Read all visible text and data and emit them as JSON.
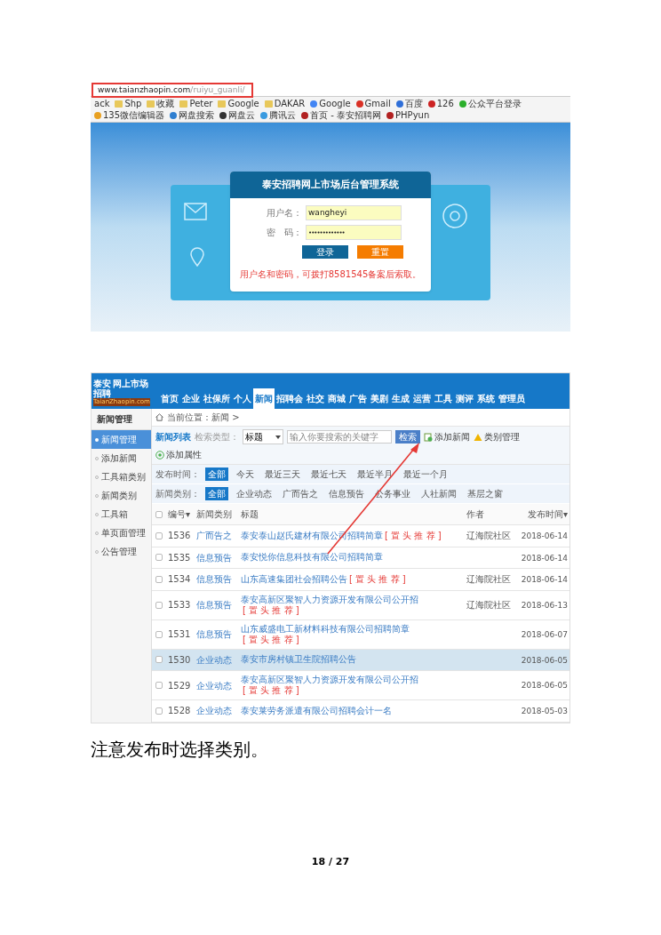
{
  "browser": {
    "url_host": "www.taianzhaopin.com",
    "url_path": "/ruiyu_guanli/",
    "url_highlighted": true,
    "bookmarks": [
      {
        "label": "ack",
        "kind": "text"
      },
      {
        "label": "Shp",
        "kind": "folder"
      },
      {
        "label": "收藏",
        "kind": "folder"
      },
      {
        "label": "Peter",
        "kind": "folder"
      },
      {
        "label": "Google",
        "kind": "folder"
      },
      {
        "label": "DAKAR",
        "kind": "folder"
      },
      {
        "label": "Google",
        "kind": "site",
        "color": "#4285f4"
      },
      {
        "label": "Gmail",
        "kind": "site",
        "color": "#d93025"
      },
      {
        "label": "百度",
        "kind": "site",
        "color": "#2f6fd8"
      },
      {
        "label": "126",
        "kind": "site",
        "color": "#cc2222"
      },
      {
        "label": "公众平台登录",
        "kind": "site",
        "color": "#2aae2a"
      },
      {
        "label": "135微信编辑器",
        "kind": "site",
        "color": "#e8a020"
      },
      {
        "label": "网盘搜索",
        "kind": "site",
        "color": "#2f7fd0"
      },
      {
        "label": "网盘云",
        "kind": "site",
        "color": "#333333"
      },
      {
        "label": "腾讯云",
        "kind": "site",
        "color": "#3a9be0"
      },
      {
        "label": "首页 - 泰安招聘网",
        "kind": "site",
        "color": "#b22222"
      },
      {
        "label": "PHPyun",
        "kind": "site",
        "color": "#b22222"
      }
    ]
  },
  "login": {
    "title": "泰安招聘网上市场后台管理系统",
    "fields": [
      {
        "label": "用户名：",
        "value": "wangheyi",
        "kind": "text"
      },
      {
        "label": "密　码：",
        "value": "•••••••••••••",
        "kind": "password"
      }
    ],
    "buttons": [
      {
        "label": "登录",
        "kind": "primary"
      },
      {
        "label": "重置",
        "kind": "reset"
      }
    ],
    "notice": "用户名和密码，可拨打8581545备案后索取。"
  },
  "admin": {
    "logo": {
      "line_1": "泰安",
      "line_2": "网上市场",
      "line_3": "招聘",
      "line_4": "TaianZhaopin.com"
    },
    "nav_tabs": [
      {
        "label": "首页",
        "selected": false
      },
      {
        "label": "企业",
        "selected": false
      },
      {
        "label": "社保所",
        "selected": false
      },
      {
        "label": "个人",
        "selected": false
      },
      {
        "label": "新闻",
        "selected": true
      },
      {
        "label": "招聘会",
        "selected": false
      },
      {
        "label": "社交",
        "selected": false
      },
      {
        "label": "商城",
        "selected": false
      },
      {
        "label": "广告",
        "selected": false
      },
      {
        "label": "美剧",
        "selected": false
      },
      {
        "label": "生成",
        "selected": false
      },
      {
        "label": "运营",
        "selected": false
      },
      {
        "label": "工具",
        "selected": false
      },
      {
        "label": "测评",
        "selected": false
      },
      {
        "label": "系统",
        "selected": false
      },
      {
        "label": "管理员",
        "selected": false
      }
    ],
    "sidebar": {
      "title": "新闻管理",
      "items": [
        {
          "label": "新闻管理",
          "selected": true
        },
        {
          "label": "添加新闻",
          "selected": false
        },
        {
          "label": "工具箱类别",
          "selected": false
        },
        {
          "label": "新闻类别",
          "selected": false
        },
        {
          "label": "工具箱",
          "selected": false
        },
        {
          "label": "单页面管理",
          "selected": false
        },
        {
          "label": "公告管理",
          "selected": false
        }
      ]
    },
    "breadcrumb": "当前位置：新闻 >",
    "toolbar": {
      "title": "新闻列表",
      "search_type_label": "检索类型：",
      "search_type_value": "标题",
      "search_placeholder": "输入你要搜索的关键字",
      "search_button": "检索",
      "actions": [
        {
          "label": "添加新闻",
          "kind": "add"
        },
        {
          "label": "类别管理",
          "kind": "category"
        },
        {
          "label": "添加属性",
          "kind": "attribute"
        }
      ]
    },
    "filters": [
      {
        "label": "发布时间：",
        "options": [
          {
            "label": "全部",
            "selected": true
          },
          {
            "label": "今天",
            "selected": false
          },
          {
            "label": "最近三天",
            "selected": false
          },
          {
            "label": "最近七天",
            "selected": false
          },
          {
            "label": "最近半月",
            "selected": false
          },
          {
            "label": "最近一个月",
            "selected": false
          }
        ]
      },
      {
        "label": "新闻类别：",
        "options": [
          {
            "label": "全部",
            "selected": true
          },
          {
            "label": "企业动态",
            "selected": false
          },
          {
            "label": "广而告之",
            "selected": false
          },
          {
            "label": "信息预告",
            "selected": false
          },
          {
            "label": "公务事业",
            "selected": false
          },
          {
            "label": "人社新闻",
            "selected": false
          },
          {
            "label": "基层之窗",
            "selected": false
          }
        ]
      }
    ],
    "table": {
      "select_all_checked": false,
      "columns": [
        "编号▾",
        "新闻类别",
        "标题",
        "作者",
        "发布时间▾"
      ],
      "rows": [
        {
          "id": "1536",
          "category": "广而告之",
          "title": "泰安泰山赵氏建材有限公司招聘简章",
          "tag": "[ 置 头 推 荐 ]",
          "author": "辽海院社区",
          "date": "2018-06-14",
          "selected": false
        },
        {
          "id": "1535",
          "category": "信息预告",
          "title": "泰安悦你信息科技有限公司招聘简章",
          "author": "",
          "date": "2018-06-14",
          "selected": false
        },
        {
          "id": "1534",
          "category": "信息预告",
          "title": "山东高速集团社会招聘公告",
          "tag": "[ 置 头 推 荐 ]",
          "author": "辽海院社区",
          "date": "2018-06-14",
          "selected": false
        },
        {
          "id": "1533",
          "category": "信息预告",
          "title": "泰安高新区聚智人力资源开发有限公司公开招",
          "tag": "[ 置 头 推 荐 ]",
          "author": "辽海院社区",
          "date": "2018-06-13",
          "selected": false
        },
        {
          "id": "1531",
          "category": "信息预告",
          "title": "山东威盛电工新材料科技有限公司招聘简章",
          "tag": "[ 置 头 推 荐 ]",
          "author": "",
          "date": "2018-06-07",
          "selected": false
        },
        {
          "id": "1530",
          "category": "企业动态",
          "title": "泰安市房村镇卫生院招聘公告",
          "author": "",
          "date": "2018-06-05",
          "selected": true
        },
        {
          "id": "1529",
          "category": "企业动态",
          "title": "泰安高新区聚智人力资源开发有限公司公开招",
          "tag": "[ 置 头 推 荐 ]",
          "author": "",
          "date": "2018-06-05",
          "selected": false
        },
        {
          "id": "1528",
          "category": "企业动态",
          "title": "泰安莱劳务派遣有限公司招聘会计一名",
          "author": "",
          "date": "2018-05-03",
          "selected": false
        }
      ]
    }
  },
  "caption": "注意发布时选择类别。",
  "footer": {
    "page": "18 / 27"
  }
}
